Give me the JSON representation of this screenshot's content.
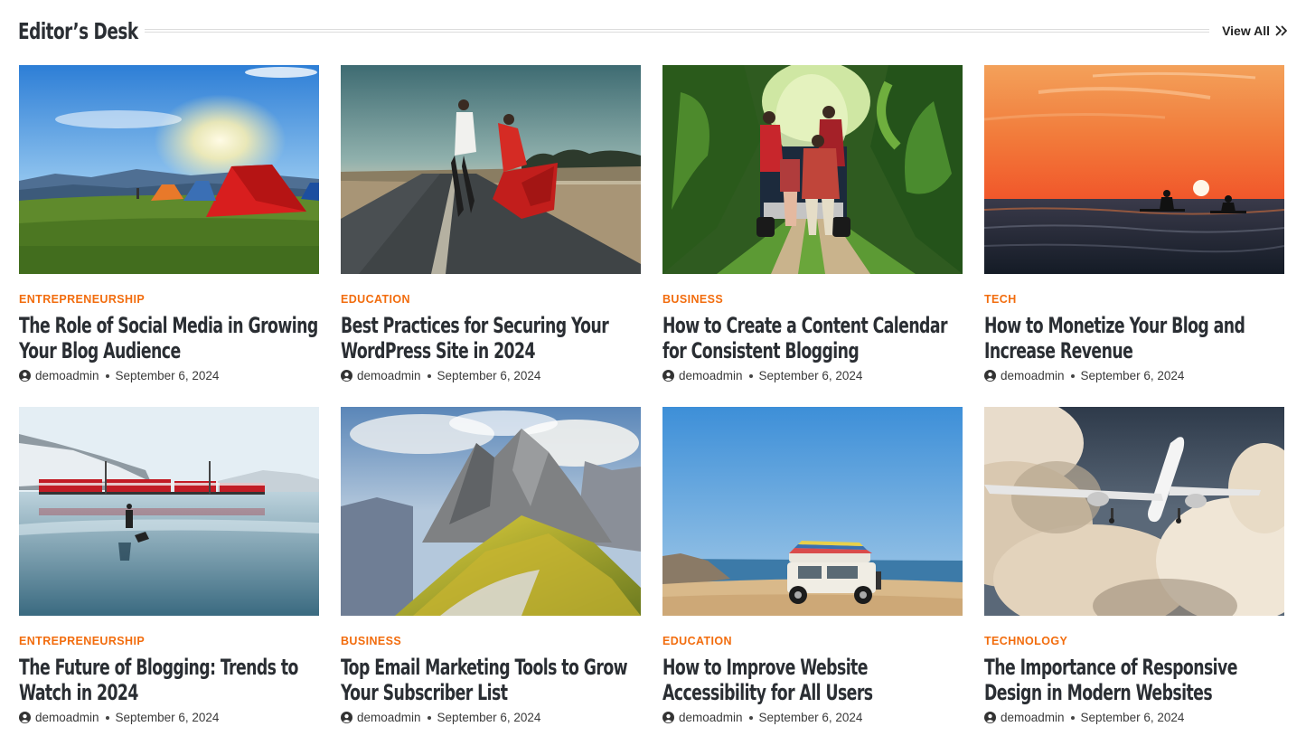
{
  "section": {
    "title": "Editor’s Desk",
    "view_all_label": "View All",
    "view_all_icon": "double-chevron-right-icon"
  },
  "colors": {
    "accent": "#f26c0d",
    "heading": "#2a2e33"
  },
  "posts": [
    {
      "category": "ENTREPRENEURSHIP",
      "title": "The Role of Social Media in Growing Your Blog Audience",
      "author": "demoadmin",
      "date": "September 6, 2024",
      "image": "camping-tents-sunrise-image"
    },
    {
      "category": "EDUCATION",
      "title": "Best Practices for Securing Your WordPress Site in 2024",
      "author": "demoadmin",
      "date": "September 6, 2024",
      "image": "dancing-couple-road-image"
    },
    {
      "category": "BUSINESS",
      "title": "How to Create a Content Calendar for Consistent Blogging",
      "author": "demoadmin",
      "date": "September 6, 2024",
      "image": "jungle-jeep-travelers-image"
    },
    {
      "category": "TECH",
      "title": "How to Monetize Your Blog and Increase Revenue",
      "author": "demoadmin",
      "date": "September 6, 2024",
      "image": "sunset-paddleboard-image"
    },
    {
      "category": "ENTREPRENEURSHIP",
      "title": "The Future of Blogging: Trends to Watch in 2024",
      "author": "demoadmin",
      "date": "September 6, 2024",
      "image": "red-train-frozen-lake-image"
    },
    {
      "category": "BUSINESS",
      "title": "Top Email Marketing Tools to Grow Your Subscriber List",
      "author": "demoadmin",
      "date": "September 6, 2024",
      "image": "mountain-peaks-image"
    },
    {
      "category": "EDUCATION",
      "title": "How to Improve Website Accessibility for All Users",
      "author": "demoadmin",
      "date": "September 6, 2024",
      "image": "white-jeep-beach-image"
    },
    {
      "category": "TECHNOLOGY",
      "title": "The Importance of Responsive Design in Modern Websites",
      "author": "demoadmin",
      "date": "September 6, 2024",
      "image": "airplane-clouds-image"
    }
  ]
}
